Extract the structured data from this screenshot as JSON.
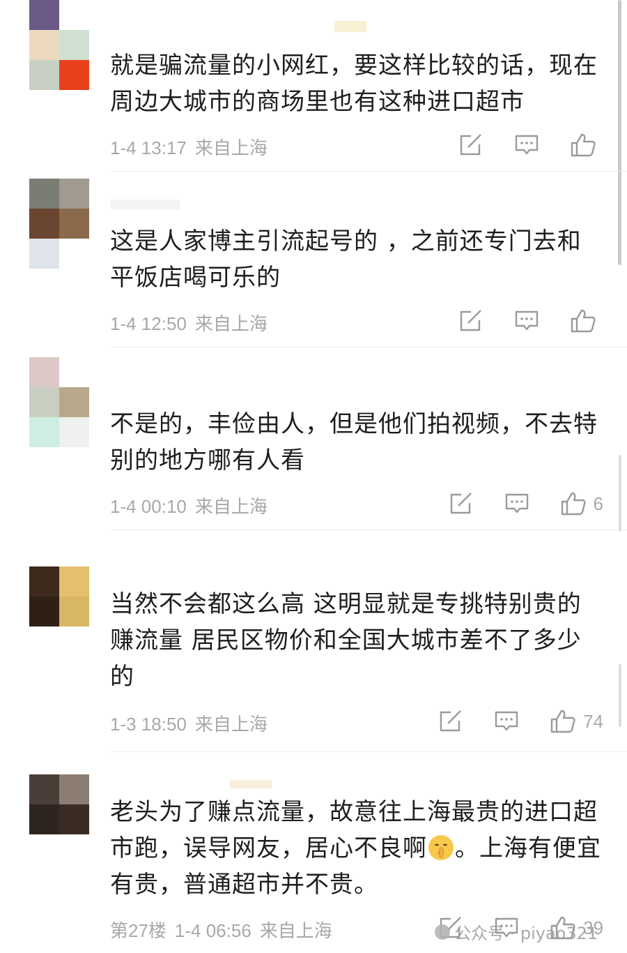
{
  "comments": [
    {
      "text": "就是骗流量的小网红，要这样比较的话，现在周边大城市的商场里也有这种进口超市",
      "date": "1-4 13:17",
      "location": "来自上海",
      "likes": ""
    },
    {
      "text": "这是人家博主引流起号的 ，之前还专门去和平饭店喝可乐的",
      "date": "1-4 12:50",
      "location": "来自上海",
      "likes": ""
    },
    {
      "text": "不是的，丰俭由人，但是他们拍视频，不去特别的地方哪有人看",
      "date": "1-4 00:10",
      "location": "来自上海",
      "likes": "6"
    },
    {
      "text": "当然不会都这么高 这明显就是专挑特别贵的赚流量 居民区物价和全国大城市差不了多少的",
      "date": "1-3 18:50",
      "location": "来自上海",
      "likes": "74"
    },
    {
      "text_before_emoji": "老头为了赚点流量，故意往上海最贵的进口超市跑，误导网友，居心不良啊",
      "emoji": "shushing-face-emoji",
      "text_after_emoji": "。上海有便宜有贵，普通超市并不贵。",
      "floor": "第27楼",
      "date": "1-4 06:56",
      "location": "来自上海",
      "likes": "39"
    }
  ],
  "icons": {
    "repost": "repost-icon",
    "comment": "comment-icon",
    "like": "thumbs-up-icon"
  },
  "watermark": {
    "label": "公众号 · piyao321"
  },
  "colors": {
    "text": "#1e1e1e",
    "meta": "#a8a8a8",
    "divider": "#ececec"
  }
}
